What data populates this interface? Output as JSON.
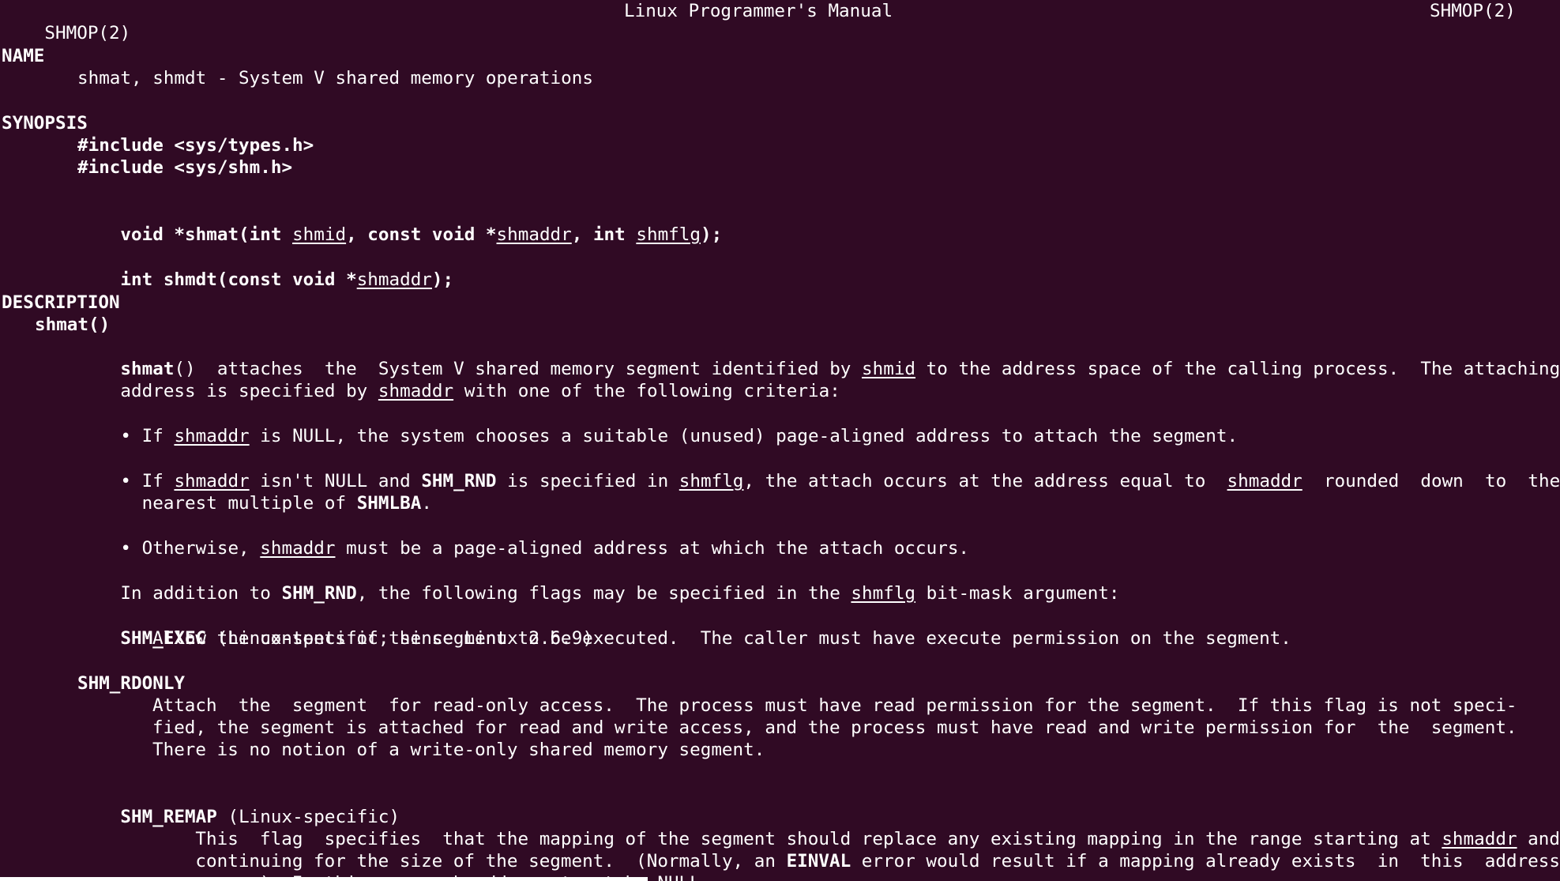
{
  "header": {
    "left": "SHMOP(2)",
    "center": "Linux Programmer's Manual",
    "right": "SHMOP(2)"
  },
  "name": {
    "heading": "NAME",
    "text": "shmat, shmdt - System V shared memory operations"
  },
  "synopsis": {
    "heading": "SYNOPSIS",
    "include1": "#include <sys/types.h>",
    "include2": "#include <sys/shm.h>",
    "shmat_proto": {
      "p1": "void *shmat(int ",
      "arg1": "shmid",
      "p2": ", const void *",
      "arg2": "shmaddr",
      "p3": ", int ",
      "arg3": "shmflg",
      "p4": ");"
    },
    "shmdt_proto": {
      "p1": "int shmdt(const void *",
      "arg1": "shmaddr",
      "p2": ");"
    }
  },
  "description": {
    "heading": "DESCRIPTION",
    "subheading": "shmat()",
    "para1": {
      "l1_fn": "shmat",
      "l1_a": "()  attaches  the  System V shared memory segment identified by ",
      "l1_arg": "shmid",
      "l1_b": " to the address space of the calling process.  The attaching",
      "l2_a": "address is specified by ",
      "l2_arg": "shmaddr",
      "l2_b": " with one of the following criteria:"
    },
    "bullet1": {
      "a": "• If ",
      "arg": "shmaddr",
      "b": " is NULL, the system chooses a suitable (unused) page-aligned address to attach the segment."
    },
    "bullet2": {
      "a": "• If ",
      "arg1": "shmaddr",
      "b": " isn't NULL and ",
      "flag": "SHM_RND",
      "c": " is specified in ",
      "arg2": "shmflg",
      "d": ", the attach occurs at the address equal to  ",
      "arg3": "shmaddr",
      "e": "  rounded  down  to  the",
      "l2_a": "  nearest multiple of ",
      "l2_flag": "SHMLBA",
      "l2_b": "."
    },
    "bullet3": {
      "a": "• Otherwise, ",
      "arg": "shmaddr",
      "b": " must be a page-aligned address at which the attach occurs."
    },
    "flags_intro": {
      "a": "In addition to ",
      "flag": "SHM_RND",
      "b": ", the following flags may be specified in the ",
      "arg": "shmflg",
      "c": " bit-mask argument:"
    },
    "shm_exec": {
      "name": "SHM_EXEC",
      "note": " (Linux-specific; since Linux 2.6.9)",
      "text": "Allow the contents of the segment to be executed.  The caller must have execute permission on the segment."
    },
    "shm_rdonly": {
      "name": "SHM_RDONLY",
      "l1": "Attach  the  segment  for read-only access.  The process must have read permission for the segment.  If this flag is not speci-",
      "l2": "fied, the segment is attached for read and write access, and the process must have read and write permission for  the  segment.",
      "l3": "There is no notion of a write-only shared memory segment."
    },
    "shm_remap": {
      "name": "SHM_REMAP",
      "note": " (Linux-specific)",
      "l1_a": "This  flag  specifies  that the mapping of the segment should replace any existing mapping in the range starting at ",
      "l1_arg": "shmaddr",
      "l1_b": " and",
      "l2_a": "continuing for the size of the segment.  (Normally, an ",
      "l2_err": "EINVAL",
      "l2_b": " error would result if a mapping already exists  in  this  address",
      "l3_a": "range.)  In this case, ",
      "l3_arg": "shmaddr",
      "l3_b": " must not be NULL."
    }
  }
}
